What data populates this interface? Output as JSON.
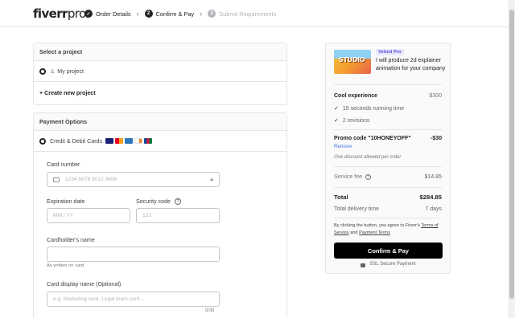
{
  "header": {
    "logo_text": "fiverr",
    "logo_suffix": "pro.",
    "steps": [
      {
        "num": "✓",
        "label": "Order Details",
        "state": "done"
      },
      {
        "num": "2",
        "label": "Confirm & Pay",
        "state": "active"
      },
      {
        "num": "3",
        "label": "Submit Requirements",
        "state": "inactive"
      }
    ]
  },
  "project": {
    "title": "Select a project",
    "my_project": "My project",
    "create_new": "+ Create new project"
  },
  "payment": {
    "title": "Payment Options",
    "method_label": "Credit & Debit Cards",
    "card_number_label": "Card number",
    "card_number_placeholder": "1234 5678 9012 3456",
    "expiration_label": "Expiration date",
    "expiration_placeholder": "MM / YY",
    "security_label": "Security code",
    "security_placeholder": "123",
    "holder_label": "Cardholder's name",
    "holder_hint": "As written on card",
    "display_label": "Card display name",
    "display_optional": "(Optional)",
    "display_placeholder": "e.g. Marketing card, Legal team card...",
    "display_counter": "0/30"
  },
  "summary": {
    "badge": "Vetted Pro",
    "gig_title": "I will produce 2d explainer animation for your company",
    "thumb_text": "STUDIO",
    "package_name": "Cool experience",
    "package_price": "$300",
    "features": [
      "15 seconds running time",
      "2 revisions"
    ],
    "promo_label": "Promo code \"10HONEYOFF\"",
    "promo_value": "-$30",
    "promo_remove": "Remove",
    "promo_note": "One discount allowed per order",
    "service_fee_label": "Service fee",
    "service_fee_value": "$14.85",
    "total_label": "Total",
    "total_value": "$284.85",
    "delivery_label": "Total delivery time",
    "delivery_value": "7 days",
    "terms_pre": "By clicking the button, you agree to Fiverr's ",
    "terms_link1": "Terms of Service",
    "terms_and": " and ",
    "terms_link2": "Payment Terms",
    "confirm_button": "Confirm & Pay",
    "ssl_label": "SSL Secure Payment"
  },
  "colors": {
    "accent": "#1dbf73",
    "button": "#000000",
    "badge_bg": "#e8e7fb",
    "badge_text": "#5c4fd6"
  }
}
